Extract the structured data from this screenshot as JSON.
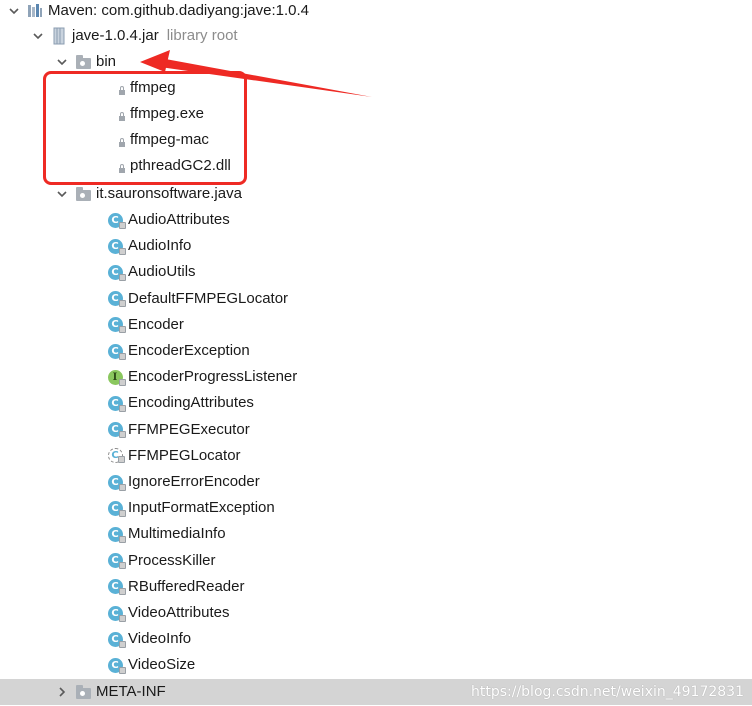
{
  "tree": {
    "root": {
      "label": "Maven: com.github.dadiyang:jave:1.0.4"
    },
    "jar": {
      "label": "jave-1.0.4.jar",
      "hint": "library root"
    },
    "bin": {
      "label": "bin",
      "files": [
        "ffmpeg",
        "ffmpeg.exe",
        "ffmpeg-mac",
        "pthreadGC2.dll"
      ]
    },
    "package": {
      "label": "it.sauronsoftware.java",
      "classes": [
        {
          "name": "AudioAttributes",
          "kind": "class",
          "letter": "C"
        },
        {
          "name": "AudioInfo",
          "kind": "class",
          "letter": "C"
        },
        {
          "name": "AudioUtils",
          "kind": "class",
          "letter": "C"
        },
        {
          "name": "DefaultFFMPEGLocator",
          "kind": "class",
          "letter": "C"
        },
        {
          "name": "Encoder",
          "kind": "class",
          "letter": "C"
        },
        {
          "name": "EncoderException",
          "kind": "class",
          "letter": "C"
        },
        {
          "name": "EncoderProgressListener",
          "kind": "interface",
          "letter": "I"
        },
        {
          "name": "EncodingAttributes",
          "kind": "class",
          "letter": "C"
        },
        {
          "name": "FFMPEGExecutor",
          "kind": "class",
          "letter": "C"
        },
        {
          "name": "FFMPEGLocator",
          "kind": "abstract",
          "letter": "C"
        },
        {
          "name": "IgnoreErrorEncoder",
          "kind": "class",
          "letter": "C"
        },
        {
          "name": "InputFormatException",
          "kind": "class",
          "letter": "C"
        },
        {
          "name": "MultimediaInfo",
          "kind": "class",
          "letter": "C"
        },
        {
          "name": "ProcessKiller",
          "kind": "class",
          "letter": "C"
        },
        {
          "name": "RBufferedReader",
          "kind": "class",
          "letter": "C"
        },
        {
          "name": "VideoAttributes",
          "kind": "class",
          "letter": "C"
        },
        {
          "name": "VideoInfo",
          "kind": "class",
          "letter": "C"
        },
        {
          "name": "VideoSize",
          "kind": "class",
          "letter": "C"
        }
      ]
    },
    "meta": {
      "label": "META-INF"
    }
  },
  "watermark": "https://blog.csdn.net/weixin_49172831",
  "colors": {
    "annotation": "#ee2a24",
    "class_icon": "#5ab1d6",
    "interface_icon": "#8ac75e",
    "selection": "#d4d4d4"
  }
}
